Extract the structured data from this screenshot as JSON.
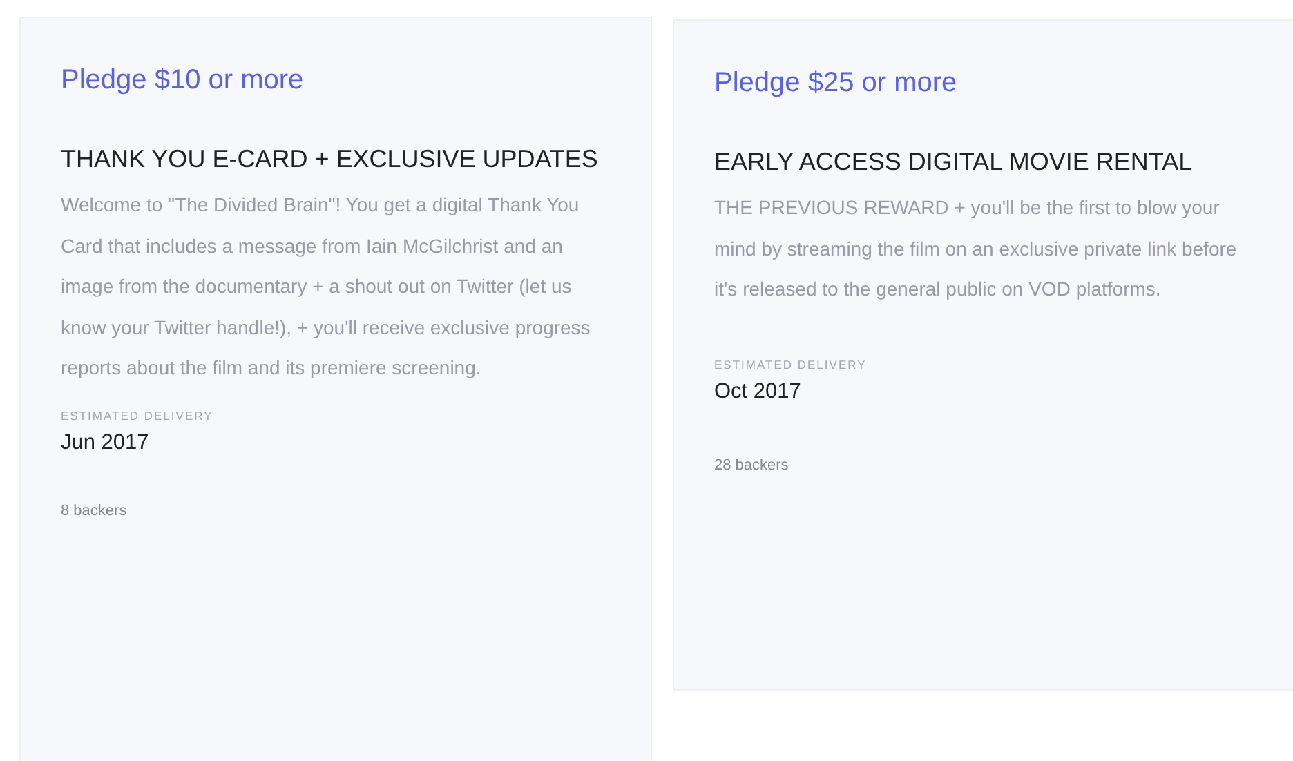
{
  "rewards": [
    {
      "pledge": "Pledge $10 or more",
      "title": "THANK YOU E-CARD + EXCLUSIVE UPDATES",
      "description": "Welcome to \"The Divided Brain\"! You get a digital Thank You Card that includes a message from Iain McGilchrist and an image from the documentary + a shout out on Twitter (let us know your Twitter handle!), + you'll receive exclusive progress reports about the film and its premiere screening.",
      "delivery_label": "ESTIMATED DELIVERY",
      "delivery": "Jun 2017",
      "backers": "8 backers"
    },
    {
      "pledge": "Pledge $25 or more",
      "title": "EARLY ACCESS DIGITAL MOVIE RENTAL",
      "description": "THE PREVIOUS REWARD + you'll be the first to blow your mind by streaming the film on an exclusive private link before it's released to the general public on VOD platforms.",
      "delivery_label": "ESTIMATED DELIVERY",
      "delivery": "Oct 2017",
      "backers": "28 backers"
    }
  ]
}
